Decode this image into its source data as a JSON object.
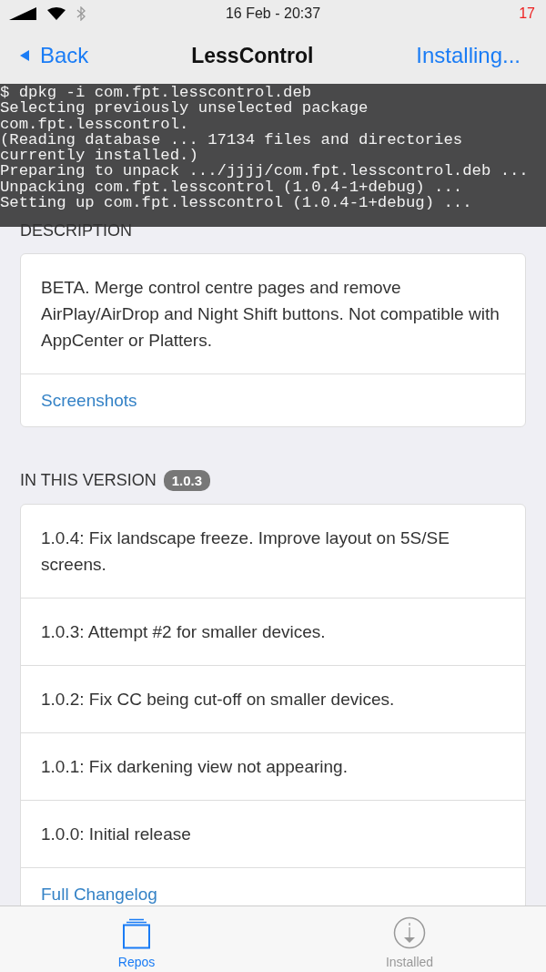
{
  "status_bar": {
    "time": "16 Feb - 20:37",
    "badge": "17"
  },
  "nav": {
    "back": "Back",
    "title": "LessControl",
    "action": "Installing..."
  },
  "console": {
    "lines": [
      "$ dpkg -i com.fpt.lesscontrol.deb",
      "Selecting previously unselected package",
      "com.fpt.lesscontrol.",
      "(Reading database ... 17134 files and directories",
      "currently installed.)",
      "Preparing to unpack .../jjjj/com.fpt.lesscontrol.deb ...",
      "Unpacking com.fpt.lesscontrol (1.0.4-1+debug) ...",
      "Setting up com.fpt.lesscontrol (1.0.4-1+debug) ..."
    ]
  },
  "description": {
    "heading": "DESCRIPTION",
    "text": "BETA. Merge control centre pages and remove AirPlay/AirDrop and Night Shift buttons. Not compatible with AppCenter or Platters.",
    "link": "Screenshots"
  },
  "version": {
    "heading": "IN THIS VERSION",
    "badge": "1.0.3",
    "items": [
      {
        "text": "1.0.4: Fix landscape freeze. Improve layout on 5S/SE screens."
      },
      {
        "text": "1.0.3: Attempt #2 for smaller devices."
      },
      {
        "text": "1.0.2: Fix CC being cut-off on smaller devices."
      },
      {
        "text": "1.0.1: Fix darkening view not appearing."
      },
      {
        "text": "1.0.0: Initial release"
      }
    ],
    "link": "Full Changelog"
  },
  "tabs": [
    {
      "label": "Repos",
      "kind": "repos",
      "selected": true
    },
    {
      "label": "Installed",
      "kind": "installed",
      "selected": false
    }
  ]
}
